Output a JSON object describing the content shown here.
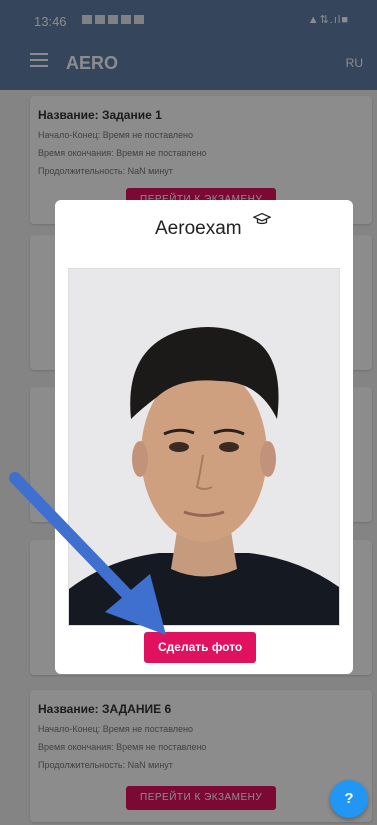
{
  "status": {
    "time": "13:46",
    "indicators": "▲⇅.ıl■"
  },
  "appbar": {
    "title": "AERO",
    "lang": "RU"
  },
  "cards": [
    {
      "title": "Название: Задание 1",
      "start_end": "Начало-Конец: Время не поставлено",
      "end_time": "Время окончания: Время не поставлено",
      "duration": "Продолжительность: NaN минут",
      "button": "ПЕРЕЙТИ К ЭКЗАМЕНУ"
    },
    {
      "title": "Название: ЗАДАНИЕ 6",
      "start_end": "Начало-Конец: Время не поставлено",
      "end_time": "Время окончания: Время не поставлено",
      "duration": "Продолжительность: NaN минут",
      "button": "ПЕРЕЙТИ К ЭКЗАМЕНУ"
    }
  ],
  "modal": {
    "logo": "Aeroexam",
    "button": "Сделать фото"
  },
  "fab": {
    "icon": "help-icon",
    "label": "?"
  },
  "colors": {
    "primary": "#5f7ea8",
    "accent": "#e0115f",
    "fab": "#2196f3",
    "arrow": "#3f6fcf"
  }
}
